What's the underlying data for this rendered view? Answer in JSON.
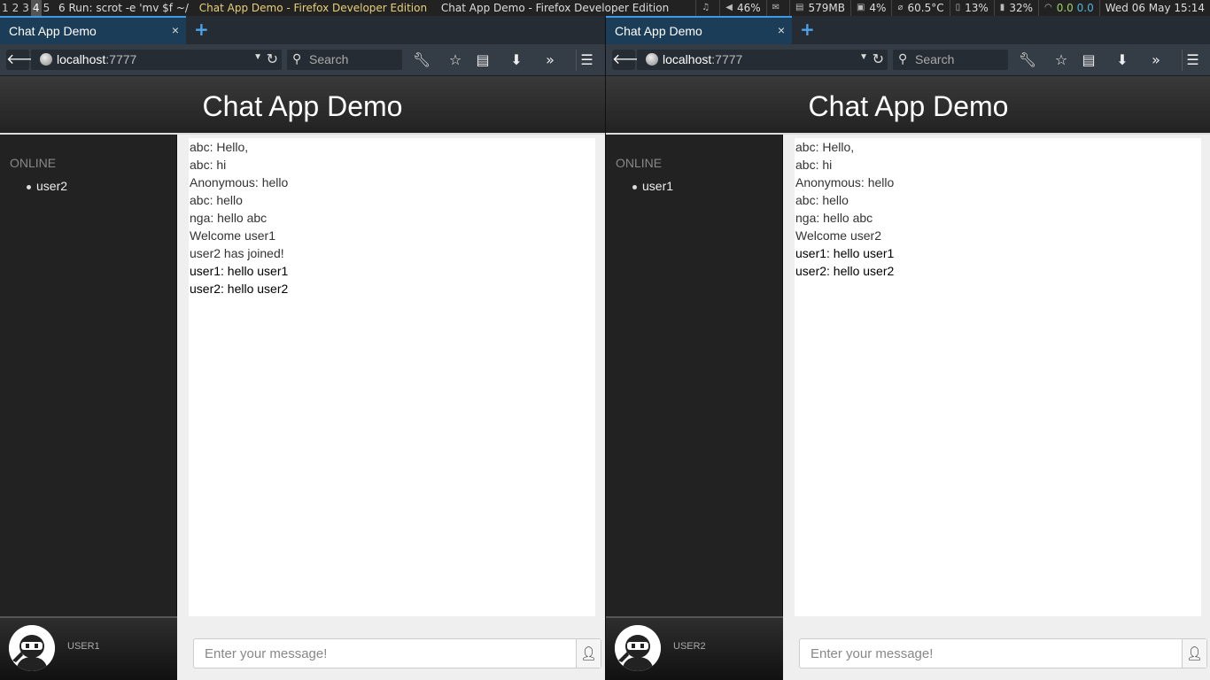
{
  "sysbar": {
    "workspaces": [
      "1",
      "2",
      "3",
      "4",
      "5"
    ],
    "active_workspace": "4",
    "run_label": "6 Run: scrot -e 'mv $f ~/",
    "active_title": "Chat App Demo - Firefox Developer Edition",
    "other_title": "Chat App Demo - Firefox Developer Edition",
    "volume": "46%",
    "memory": "579MB",
    "cpu": "4%",
    "temp": "60.5°C",
    "disk": "13%",
    "battery": "32%",
    "net_down": "0.0",
    "net_up": "0.0",
    "clock": "Wed 06 May  15:14"
  },
  "browser": {
    "tab_label": "Chat App Demo",
    "close_glyph": "×",
    "newtab_glyph": "+",
    "url_host": "localhost",
    "url_port": ":7777",
    "search_placeholder": "Search"
  },
  "app": {
    "title": "Chat App Demo",
    "online_label": "ONLINE",
    "input_placeholder": "Enter your message!"
  },
  "left": {
    "online_users": [
      "user2"
    ],
    "profile_name": "USER1",
    "messages": [
      {
        "text": "abc: Hello,",
        "strong": false
      },
      {
        "text": "abc: hi",
        "strong": false
      },
      {
        "text": "Anonymous: hello",
        "strong": false
      },
      {
        "text": "abc: hello",
        "strong": false
      },
      {
        "text": "nga: hello abc",
        "strong": false
      },
      {
        "text": "Welcome user1",
        "strong": false
      },
      {
        "text": "user2 has joined!",
        "strong": false
      },
      {
        "text": "user1: hello user1",
        "strong": true
      },
      {
        "text": "user2: hello user2",
        "strong": true
      }
    ]
  },
  "right": {
    "online_users": [
      "user1"
    ],
    "profile_name": "USER2",
    "messages": [
      {
        "text": "abc: Hello,",
        "strong": false
      },
      {
        "text": "abc: hi",
        "strong": false
      },
      {
        "text": "Anonymous: hello",
        "strong": false
      },
      {
        "text": "abc: hello",
        "strong": false
      },
      {
        "text": "nga: hello abc",
        "strong": false
      },
      {
        "text": "Welcome user2",
        "strong": false
      },
      {
        "text": "user1: hello user1",
        "strong": true
      },
      {
        "text": "user2: hello user2",
        "strong": true
      }
    ]
  },
  "colors": {
    "tab_active": "#1c3d57",
    "tab_accent": "#3d9ae6",
    "sysbar_title": "#e8d07a"
  }
}
